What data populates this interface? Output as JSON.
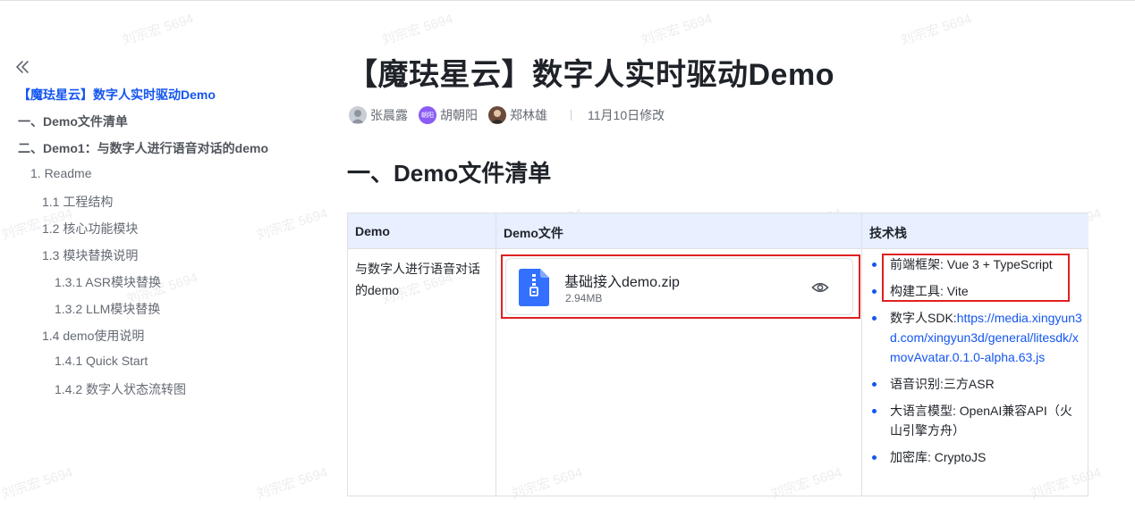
{
  "watermark": "刘宗宏 5694",
  "sidebar": {
    "collapse_glyph": "«",
    "items": [
      {
        "label": "【魔珐星云】数字人实时驱动Demo",
        "level": 0,
        "active": true
      },
      {
        "label": "一、Demo文件清单",
        "level": 1
      },
      {
        "label": "二、Demo1：与数字人进行语音对话的demo",
        "level": 1
      },
      {
        "label": "1. Readme",
        "level": 2
      },
      {
        "label": "1.1 工程结构",
        "level": 3
      },
      {
        "label": "1.2 核心功能模块",
        "level": 3
      },
      {
        "label": "1.3 模块替换说明",
        "level": 3
      },
      {
        "label": "1.3.1 ASR模块替换",
        "level": 4
      },
      {
        "label": "1.3.2 LLM模块替换",
        "level": 4
      },
      {
        "label": "1.4 demo使用说明",
        "level": 3
      },
      {
        "label": "1.4.1 Quick Start",
        "level": 4
      },
      {
        "label": "1.4.2 数字人状态流转图",
        "level": 4
      }
    ]
  },
  "doc": {
    "title": "【魔珐星云】数字人实时驱动Demo",
    "authors": [
      {
        "name": "张晨露",
        "avatar_text": ""
      },
      {
        "name": "胡朝阳",
        "avatar_text": "朝阳"
      },
      {
        "name": "郑林雄",
        "avatar_text": ""
      }
    ],
    "modified": "11月10日修改",
    "section_heading": "一、Demo文件清单"
  },
  "table": {
    "headers": [
      "Demo",
      "Demo文件",
      "技术栈"
    ],
    "row": {
      "demo": "与数字人进行语音对话的demo",
      "file": {
        "name": "基础接入demo.zip",
        "size": "2.94MB",
        "icon": "zip-file-icon"
      },
      "stack": [
        {
          "label": "前端框架: Vue 3 + TypeScript"
        },
        {
          "label": "构建工具: Vite"
        },
        {
          "label": "数字人SDK:",
          "link": "https://media.xingyun3d.com/xingyun3d/general/litesdk/xmovAvatar.0.1.0-alpha.63.js"
        },
        {
          "label": "语音识别:三方ASR"
        },
        {
          "label": "大语言模型: OpenAI兼容API（火山引擎方舟）"
        },
        {
          "label": "加密库: CryptoJS"
        }
      ]
    }
  },
  "colors": {
    "accent": "#1456f0",
    "header_bg": "#e8efff",
    "highlight": "#e02020",
    "zip_icon": "#3370ff"
  }
}
